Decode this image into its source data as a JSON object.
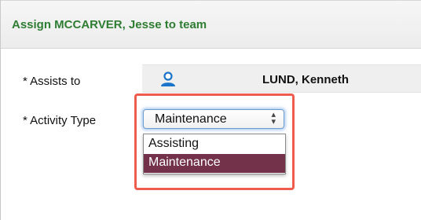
{
  "dialog": {
    "title": "Assign MCCARVER, Jesse to team"
  },
  "form": {
    "assists_label": "* Assists to",
    "assists_value": "LUND, Kenneth",
    "activity_label": "* Activity Type",
    "activity_selected": "Maintenance",
    "activity_options": [
      "Assisting",
      "Maintenance"
    ]
  },
  "icons": {
    "assignee": "person-icon",
    "select_arrows": "up-down-arrows-icon"
  },
  "colors": {
    "title": "#2e7d32",
    "highlight": "#ee5c4e",
    "selected_option_bg": "#73324a",
    "person_icon": "#1a74c9"
  }
}
